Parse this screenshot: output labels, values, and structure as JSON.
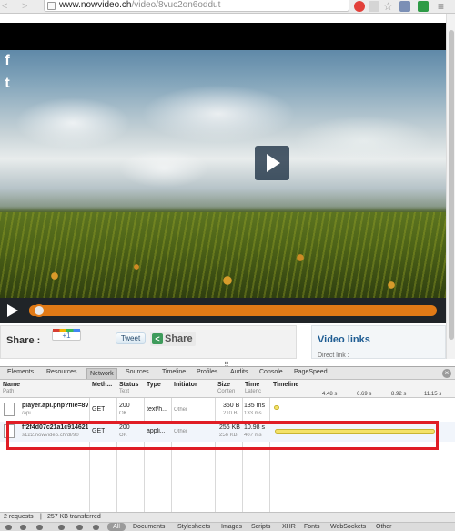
{
  "browser": {
    "back_glyph": "<",
    "forward_glyph": ">",
    "url_host": "www.nowvideo.ch",
    "url_path": "/video/8vuc2on6oddut",
    "star_glyph": "☆",
    "menu_glyph": "≡"
  },
  "page": {
    "social_facebook": "f",
    "social_twitter": "t",
    "player": {
      "progress_fraction": 0.01
    },
    "share": {
      "label": "Share :",
      "gplus_label": "+1",
      "tweet_label": "Tweet",
      "share_button_label": "Share",
      "share_icon_glyph": "<"
    },
    "video_links": {
      "title": "Video links",
      "subtitle": "Direct link :"
    }
  },
  "devtools": {
    "grip_glyph": "⠿",
    "tabs": [
      "Elements",
      "Resources",
      "Network",
      "Sources",
      "Timeline",
      "Profiles",
      "Audits",
      "Console",
      "PageSpeed"
    ],
    "active_tab": "Network",
    "close_glyph": "×",
    "network": {
      "columns": {
        "name": {
          "main": "Name",
          "sub": "Path"
        },
        "method": {
          "main": "Meth..."
        },
        "status": {
          "main": "Status",
          "sub": "Text"
        },
        "type": {
          "main": "Type"
        },
        "initiator": {
          "main": "Initiator"
        },
        "size": {
          "main": "Size",
          "sub": "Conten"
        },
        "time": {
          "main": "Time",
          "sub": "Latenc"
        },
        "timeline": {
          "main": "Timeline"
        }
      },
      "timeline_ticks": [
        "4.48 s",
        "6.69 s",
        "8.92 s",
        "11.15 s"
      ],
      "rows": [
        {
          "name": "player.api.php?file=8v",
          "path": "/api",
          "method": "GET",
          "status": "200",
          "status_text": "OK",
          "type": "text/h...",
          "initiator": "Other",
          "size": "350 B",
          "content": "210 B",
          "time": "135 ms",
          "latency": "133 ms"
        },
        {
          "name": "ff2f4d07c21a1c914621",
          "path": "s122.nowvideo.ch/dl/90",
          "method": "GET",
          "status": "200",
          "status_text": "OK",
          "type": "appli...",
          "initiator": "Other",
          "size": "256 KB",
          "content": "256 KB",
          "time": "10.98 s",
          "latency": "407 ms"
        }
      ]
    },
    "status": {
      "requests": "2 requests",
      "separator": "|",
      "transferred": "257 KB transferred"
    },
    "filters": [
      "Documents",
      "Stylesheets",
      "Images",
      "Scripts",
      "XHR",
      "Fonts",
      "WebSockets",
      "Other"
    ],
    "filter_all": "All"
  }
}
